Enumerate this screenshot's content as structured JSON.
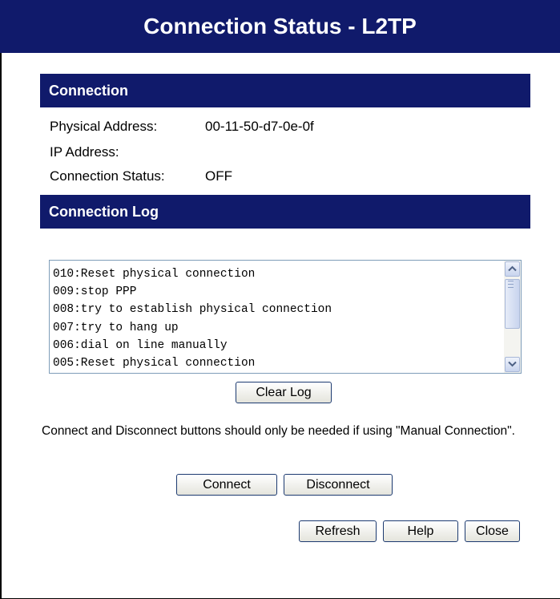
{
  "window": {
    "title": "Connection Status - L2TP"
  },
  "connection": {
    "heading": "Connection",
    "physical_address_label": "Physical Address:",
    "physical_address_value": "00-11-50-d7-0e-0f",
    "ip_address_label": "IP Address:",
    "ip_address_value": "",
    "status_label": "Connection Status:",
    "status_value": "OFF"
  },
  "log": {
    "heading": "Connection Log",
    "lines": [
      "010:Reset physical connection",
      "009:stop PPP",
      "008:try to establish physical connection",
      "007:try to hang up",
      "006:dial on line manually",
      "005:Reset physical connection"
    ],
    "clear_label": "Clear Log"
  },
  "note": "Connect and Disconnect buttons should only be needed if using \"Manual Connection\".",
  "buttons": {
    "connect": "Connect",
    "disconnect": "Disconnect",
    "refresh": "Refresh",
    "help": "Help",
    "close": "Close"
  },
  "colors": {
    "header_bg": "#101a6b",
    "header_text": "#ffffff"
  }
}
